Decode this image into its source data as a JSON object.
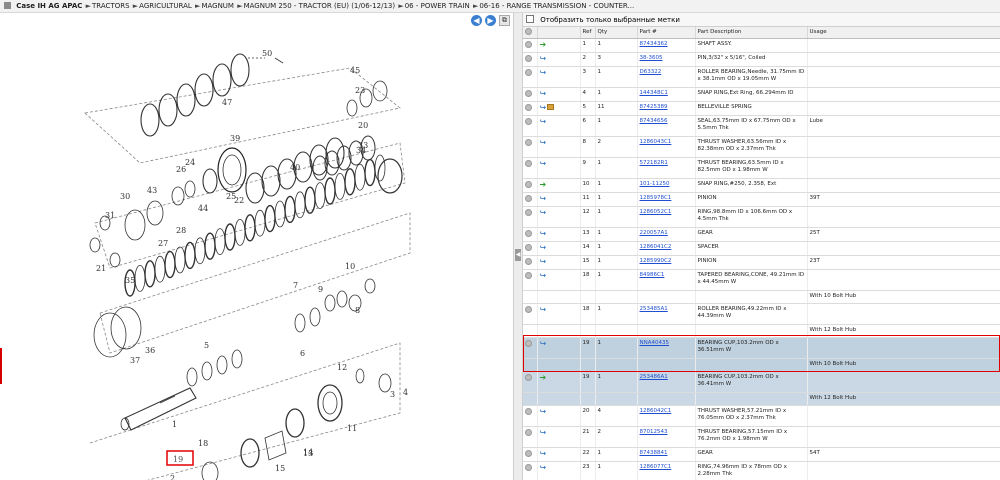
{
  "breadcrumb": {
    "items": [
      {
        "label": "Case IH AG APAC",
        "bold": true
      },
      {
        "label": "TRACTORS",
        "bold": false
      },
      {
        "label": "AGRICULTURAL",
        "bold": false
      },
      {
        "label": "MAGNUM",
        "bold": false
      },
      {
        "label": "MAGNUM 250 - TRACTOR (EU) (1/06-12/13)",
        "bold": false
      },
      {
        "label": "06 - POWER TRAIN",
        "bold": false
      },
      {
        "label": "06-16 - RANGE TRANSMISSION - COUNTER...",
        "bold": false
      }
    ],
    "separator": "►"
  },
  "toolbar": {
    "prev": "◀",
    "next": "▶",
    "popout": "⧉"
  },
  "filter": {
    "label": "Отобразить только выбранные метки"
  },
  "table": {
    "headers": [
      "Ref",
      "Qty",
      "Part #",
      "Part Description",
      "Usage"
    ],
    "rows": [
      {
        "ref": "1",
        "qty": "1",
        "part": "87434362",
        "desc": "SHAFT ASSY.",
        "usage": "",
        "icon": "green",
        "tall": false
      },
      {
        "ref": "2",
        "qty": "3",
        "part": "38-3605",
        "desc": "PIN,3/32\" x 5/16\", Coiled",
        "usage": "",
        "icon": "blue",
        "tall": false
      },
      {
        "ref": "3",
        "qty": "1",
        "part": "D63322",
        "desc": "ROLLER BEARING,Needle, 31.75mm ID x 38.1mm OD x 19.05mm W",
        "usage": "",
        "icon": "blue",
        "tall": true
      },
      {
        "ref": "4",
        "qty": "1",
        "part": "144348C1",
        "desc": "SNAP RING,Ext Ring, 66.294mm ID",
        "usage": "",
        "icon": "blue",
        "tall": false
      },
      {
        "ref": "5",
        "qty": "11",
        "part": "87425389",
        "desc": "BELLEVILLE SPRING",
        "usage": "",
        "icon": "blue-box",
        "tall": false
      },
      {
        "ref": "6",
        "qty": "1",
        "part": "87434656",
        "desc": "SEAL,63.75mm ID x 67.75mm OD x 5.5mm Thk",
        "usage": "Lube",
        "icon": "blue",
        "tall": true
      },
      {
        "ref": "8",
        "qty": "2",
        "part": "1286043C1",
        "desc": "THRUST WASHER,63.56mm ID x 82.38mm OD x 2.37mm Thk",
        "usage": "",
        "icon": "blue",
        "tall": true
      },
      {
        "ref": "9",
        "qty": "1",
        "part": "572182R1",
        "desc": "THRUST BEARING,63.5mm ID x 82.5mm OD x 1.98mm W",
        "usage": "",
        "icon": "blue",
        "tall": true
      },
      {
        "ref": "10",
        "qty": "1",
        "part": "101-11250",
        "desc": "SNAP RING,#250, 2.358, Ext",
        "usage": "",
        "icon": "green",
        "tall": false
      },
      {
        "ref": "11",
        "qty": "1",
        "part": "1285978C1",
        "desc": "PINION",
        "usage": "39T",
        "icon": "blue",
        "tall": false
      },
      {
        "ref": "12",
        "qty": "1",
        "part": "1286052C1",
        "desc": "RING,98.8mm ID x 106.6mm OD x 4.5mm Thk",
        "usage": "",
        "icon": "blue",
        "tall": true
      },
      {
        "ref": "13",
        "qty": "1",
        "part": "220057A1",
        "desc": "GEAR",
        "usage": "25T",
        "icon": "blue",
        "tall": false
      },
      {
        "ref": "14",
        "qty": "1",
        "part": "1286041C2",
        "desc": "SPACER",
        "usage": "",
        "icon": "blue",
        "tall": false
      },
      {
        "ref": "15",
        "qty": "1",
        "part": "1285990C2",
        "desc": "PINION",
        "usage": "23T",
        "icon": "blue",
        "tall": false
      },
      {
        "ref": "18",
        "qty": "1",
        "part": "84986C1",
        "desc": "TAPERED BEARING,CONE, 49.21mm ID x 44.45mm W",
        "usage": "",
        "icon": "blue",
        "tall": true
      },
      {
        "sub": true,
        "usage": "With 10 Bolt Hub"
      },
      {
        "ref": "18",
        "qty": "1",
        "part": "253485A1",
        "desc": "ROLLER BEARING,49.22mm ID x 44.39mm W",
        "usage": "",
        "icon": "blue",
        "tall": true
      },
      {
        "sub": true,
        "usage": "With 12 Bolt Hub"
      },
      {
        "ref": "19",
        "qty": "1",
        "part": "NNA40435",
        "desc": "BEARING CUP,103.2mm OD x 36.51mm W",
        "usage": "",
        "icon": "blue",
        "tall": true,
        "highlight": true
      },
      {
        "sub": true,
        "usage": "With 10 Bolt Hub",
        "highlight": true
      },
      {
        "ref": "19",
        "qty": "1",
        "part": "253486A1",
        "desc": "BEARING CUP,103.2mm OD x 36.41mm W",
        "usage": "",
        "icon": "green",
        "tall": true,
        "selected": true
      },
      {
        "sub": true,
        "usage": "With 12 Bolt Hub",
        "selected": true
      },
      {
        "ref": "20",
        "qty": "4",
        "part": "1286042C1",
        "desc": "THRUST WASHER,57.21mm ID x 76.05mm OD x 2.37mm Thk",
        "usage": "",
        "icon": "blue",
        "tall": true
      },
      {
        "ref": "21",
        "qty": "2",
        "part": "87012543",
        "desc": "THRUST BEARING,57.15mm ID x 76.2mm OD x 1.98mm W",
        "usage": "",
        "icon": "blue",
        "tall": true
      },
      {
        "ref": "22",
        "qty": "1",
        "part": "87438841",
        "desc": "GEAR",
        "usage": "54T",
        "icon": "blue",
        "tall": false
      },
      {
        "ref": "23",
        "qty": "1",
        "part": "1286077C1",
        "desc": "RING,74.96mm ID x 78mm OD x 2.28mm Thk",
        "usage": "",
        "icon": "blue",
        "tall": true
      }
    ]
  },
  "diagram": {
    "callouts": [
      "1",
      "2",
      "3",
      "4",
      "5",
      "6",
      "7",
      "8",
      "9",
      "10",
      "11",
      "12",
      "13",
      "14",
      "15",
      "18",
      "19",
      "20",
      "21",
      "22",
      "23",
      "24",
      "25",
      "26",
      "27",
      "28",
      "30",
      "31",
      "33",
      "34",
      "35",
      "36",
      "37",
      "39",
      "40",
      "43",
      "44",
      "45",
      "47",
      "50"
    ],
    "selected_callout": "19"
  },
  "colors": {
    "highlight_row": "#bfd0de",
    "link": "#1f4fd0",
    "red_frame": "#e00000"
  }
}
